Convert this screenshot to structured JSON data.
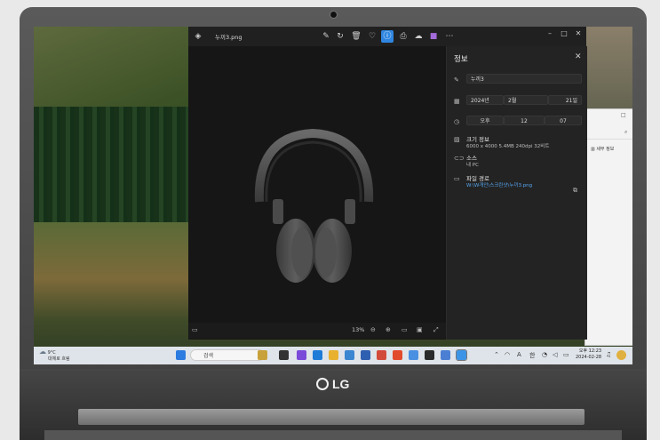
{
  "brand": {
    "logo_text": "LG"
  },
  "app": {
    "filename": "누끼3.png",
    "zoom": "13%",
    "info_panel": {
      "title": "정보",
      "name_value": "누끼3",
      "date": {
        "year": "2024년",
        "month": "2월",
        "day": "21일"
      },
      "time": {
        "ampm": "오후",
        "hour": "12",
        "minute": "07"
      },
      "size_label": "크기 정보",
      "size_values": "6000 x 4000   5.4MB   240dpi   32비트",
      "source_label": "소스",
      "source_value": "내 PC",
      "path_label": "파일 경로",
      "path_value": "W:\\W개인\\스크린샷\\누끼3.png"
    }
  },
  "back_window": {
    "details_label": "세부 정보"
  },
  "taskbar": {
    "weather_temp": "9°C",
    "weather_text": "대체로 흐림",
    "search_placeholder": "검색",
    "lang": "한",
    "time": "오후 12:23",
    "date": "2024-02-28"
  },
  "colors": {
    "accent": "#2f86e0",
    "app_bg": "#1c1c1c",
    "panel_bg": "#232323",
    "taskbar_bg": "#dfe4ea"
  }
}
